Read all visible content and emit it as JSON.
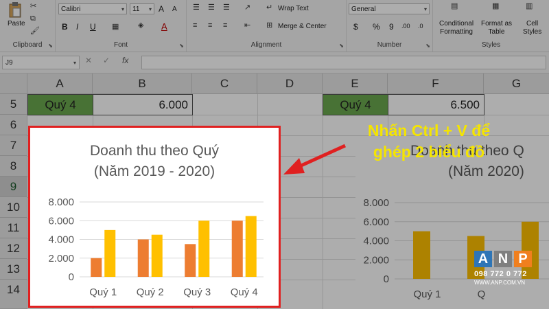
{
  "ribbon": {
    "clipboard": {
      "paste_label": "Paste",
      "group_label": "Clipboard"
    },
    "font": {
      "font_name": "Calibri",
      "font_size": "11",
      "grow_font": "A",
      "shrink_font": "A",
      "bold": "B",
      "italic": "I",
      "underline": "U",
      "font_color_glyph": "A",
      "group_label": "Font"
    },
    "alignment": {
      "wrap_text": "Wrap Text",
      "merge_center": "Merge & Center",
      "group_label": "Alignment"
    },
    "number": {
      "format": "General",
      "currency": "$",
      "percent": "%",
      "comma": "9",
      "inc_decimal": ".00",
      "dec_decimal": ".0",
      "group_label": "Number"
    },
    "styles": {
      "conditional_formatting": "Conditional\nFormatting",
      "format_as_table": "Format as\nTable",
      "cell_styles": "Cell\nStyles",
      "group_label": "Styles"
    }
  },
  "formula_bar": {
    "name_box": "J9",
    "fx": "fx",
    "cancel": "✕",
    "enter": "✓",
    "formula": ""
  },
  "sheet": {
    "columns": [
      "A",
      "B",
      "C",
      "D",
      "E",
      "F",
      "G"
    ],
    "rows": [
      "5",
      "6",
      "7",
      "8",
      "9",
      "10",
      "11",
      "12",
      "13",
      "14"
    ],
    "selected_row": "9",
    "cells": {
      "A5": "Quý 4",
      "B5": "6.000",
      "E5": "Quý 4",
      "F5": "6.500"
    }
  },
  "chart_data": [
    {
      "type": "bar",
      "title": "Doanh thu theo Quý",
      "subtitle": "(Năm 2019 - 2020)",
      "categories": [
        "Quý 1",
        "Quý 2",
        "Quý 3",
        "Quý 4"
      ],
      "series": [
        {
          "values": [
            2000,
            4000,
            3500,
            6000
          ],
          "color": "#ed7d31"
        },
        {
          "values": [
            5000,
            4500,
            6000,
            6500
          ],
          "color": "#ffc000"
        }
      ],
      "yticks": [
        "0",
        "2.000",
        "4.000",
        "6.000",
        "8.000"
      ],
      "ylim": [
        0,
        8000
      ],
      "grid": true
    },
    {
      "type": "bar",
      "title": "Doanh thu theo Q",
      "subtitle": "(Năm 2020)",
      "categories": [
        "Quý 1",
        "Q"
      ],
      "series": [
        {
          "values": [
            5000,
            4500,
            6000
          ],
          "color": "#ffc000"
        }
      ],
      "yticks": [
        "0",
        "2.000",
        "4.000",
        "6.000",
        "8.000"
      ],
      "ylim": [
        0,
        8000
      ],
      "grid": true
    }
  ],
  "annotation": {
    "line1": "Nhấn Ctrl + V để",
    "line2": "ghép 2 biểu đồ",
    "arrow_color": "#e02020"
  },
  "watermark": {
    "letters": [
      "A",
      "N",
      "P"
    ],
    "phone": "098 772 0 772",
    "site": "WWW.ANP.COM.VN",
    "colors": [
      "#2e75b6",
      "#7f7f7f",
      "#f07f1e"
    ]
  }
}
